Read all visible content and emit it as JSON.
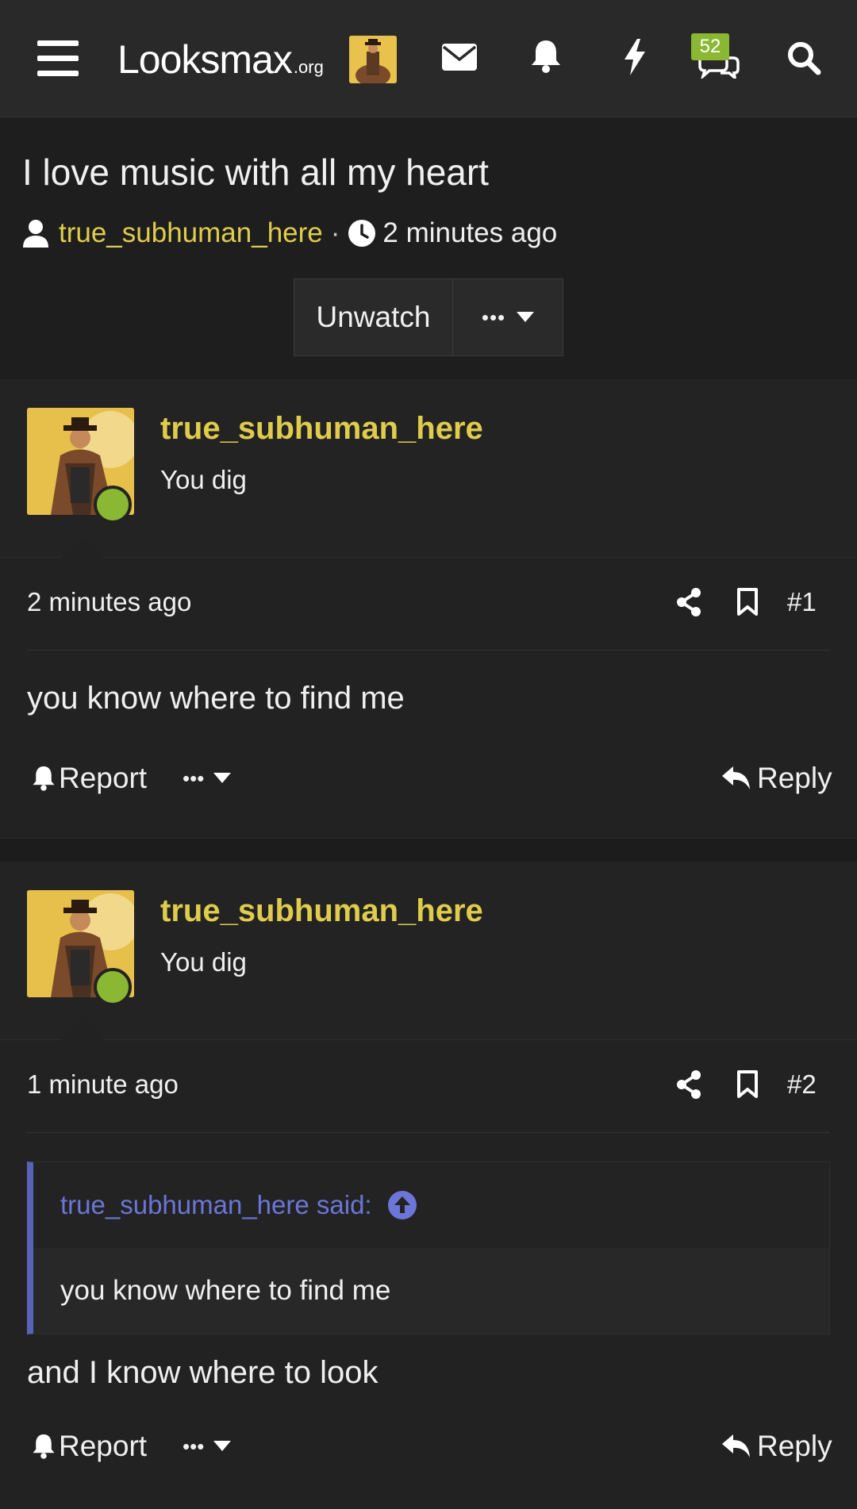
{
  "header": {
    "site_name": "Looksmax",
    "site_tld": ".org",
    "conversations_badge": "52"
  },
  "thread": {
    "title": "I love music with all my heart",
    "author": "true_subhuman_here",
    "separator": "·",
    "time": "2 minutes ago",
    "unwatch_label": "Unwatch",
    "more_label": "•••"
  },
  "posts": [
    {
      "username": "true_subhuman_here",
      "user_title": "You dig",
      "date": "2 minutes ago",
      "number": "#1",
      "message": "you know where to find me",
      "report_label": "Report",
      "more_label": "•••",
      "reply_label": "Reply"
    },
    {
      "username": "true_subhuman_here",
      "user_title": "You dig",
      "date": "1 minute ago",
      "number": "#2",
      "quote_author": "true_subhuman_here said:",
      "quote_text": "you know where to find me",
      "message": "and I know where to look",
      "report_label": "Report",
      "more_label": "•••",
      "reply_label": "Reply"
    }
  ],
  "colors": {
    "accent_username": "#e0cc4c",
    "online": "#8ab832",
    "quote_accent": "#5a62b8"
  }
}
